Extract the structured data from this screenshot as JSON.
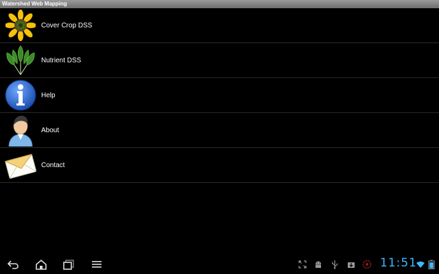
{
  "app": {
    "title": "Watershed Web Mapping"
  },
  "menu": {
    "items": [
      {
        "label": "Cover Crop DSS",
        "icon": "sunflower-icon"
      },
      {
        "label": "Nutrient DSS",
        "icon": "plant-leaves-icon"
      },
      {
        "label": "Help",
        "icon": "info-icon"
      },
      {
        "label": "About",
        "icon": "person-icon"
      },
      {
        "label": "Contact",
        "icon": "envelope-icon"
      }
    ]
  },
  "status_bar": {
    "time": "11:51"
  },
  "colors": {
    "background": "#000000",
    "title_bar": "#8a8a8a",
    "clock": "#3fb8ff",
    "info_blue": "#2a6fd6"
  }
}
